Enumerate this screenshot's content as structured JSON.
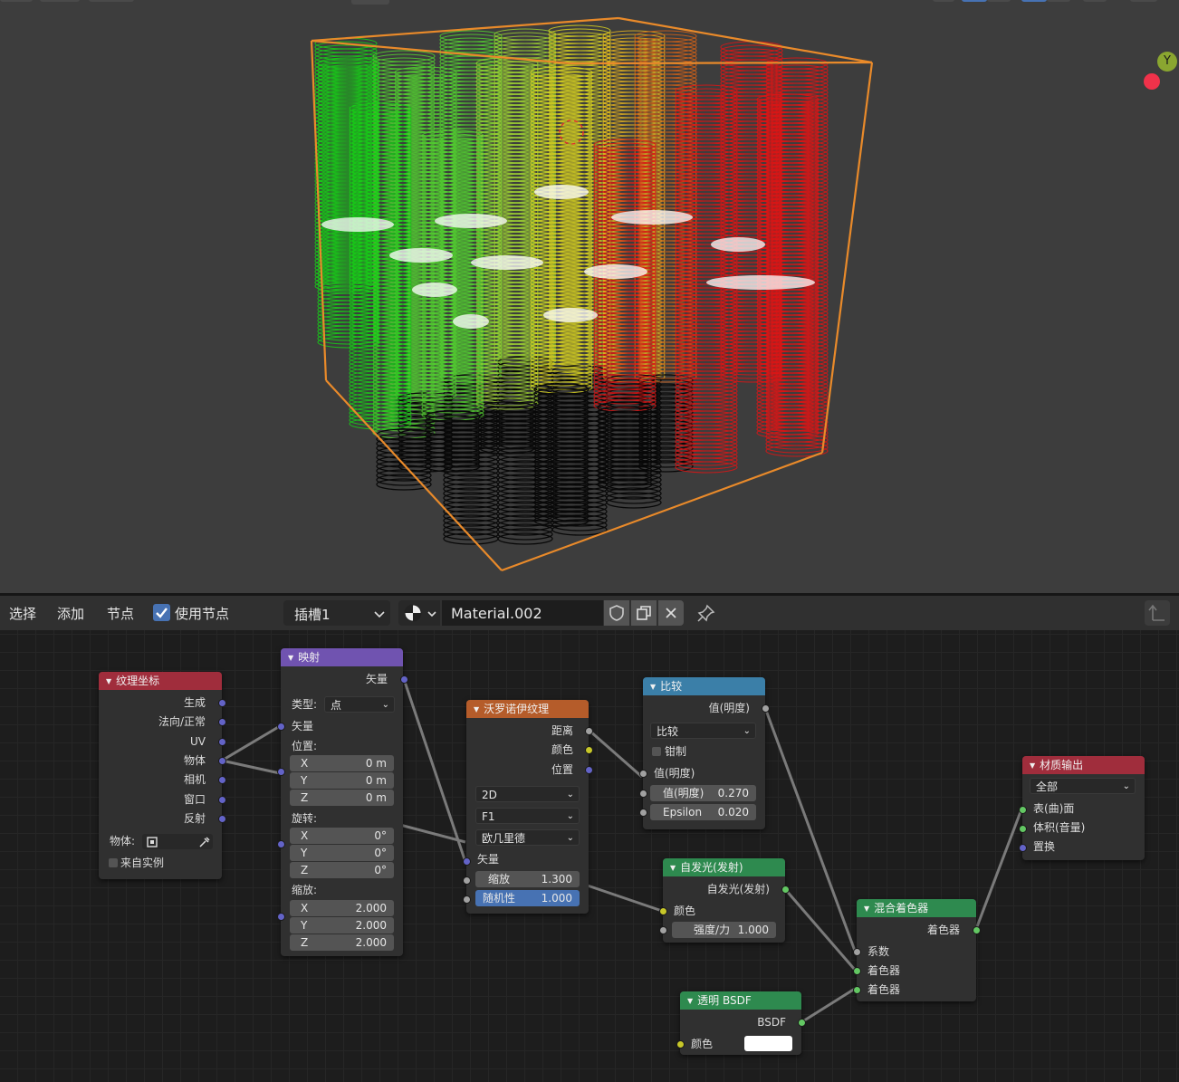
{
  "viewport": {
    "axis_label": "Y",
    "gizmo_color_y": "#8aa630",
    "gizmo_color_x": "#f0324a",
    "bbox_color": "#e98a2a",
    "spring_colors": [
      "#16d016",
      "#52d030",
      "#9acd32",
      "#d6d020",
      "#e0b020",
      "#d06018",
      "#e01414"
    ]
  },
  "header": {
    "menu": [
      "选择",
      "添加",
      "节点"
    ],
    "use_nodes_label": "使用节点",
    "slot": "插槽1",
    "material_name": "Material.002",
    "icons": [
      "sphere-preview-icon",
      "shield-icon",
      "copy-icon",
      "close-icon",
      "pin-icon",
      "parent-icon"
    ]
  },
  "nodes": {
    "tex_coord": {
      "title": "纹理坐标",
      "color": "#a02d3c",
      "outputs": [
        "生成",
        "法向/正常",
        "UV",
        "物体",
        "相机",
        "窗口",
        "反射"
      ],
      "object_label": "物体:",
      "from_instancer": "来自实例"
    },
    "mapping": {
      "title": "映射",
      "color": "#7053b0",
      "output": "矢量",
      "type_label": "类型:",
      "type_value": "点",
      "vector_in": "矢量",
      "location_label": "位置:",
      "location": [
        {
          "axis": "X",
          "value": "0 m"
        },
        {
          "axis": "Y",
          "value": "0 m"
        },
        {
          "axis": "Z",
          "value": "0 m"
        }
      ],
      "rotation_label": "旋转:",
      "rotation": [
        {
          "axis": "X",
          "value": "0°"
        },
        {
          "axis": "Y",
          "value": "0°"
        },
        {
          "axis": "Z",
          "value": "0°"
        }
      ],
      "scale_label": "缩放:",
      "scale": [
        {
          "axis": "X",
          "value": "2.000"
        },
        {
          "axis": "Y",
          "value": "2.000"
        },
        {
          "axis": "Z",
          "value": "2.000"
        }
      ]
    },
    "voronoi": {
      "title": "沃罗诺伊纹理",
      "color": "#b55c2a",
      "outputs": [
        "距离",
        "颜色",
        "位置"
      ],
      "dim": "2D",
      "feature": "F1",
      "metric": "欧几里德",
      "vector_in": "矢量",
      "scale_label": "缩放",
      "scale_value": "1.300",
      "random_label": "随机性",
      "random_value": "1.000"
    },
    "compare": {
      "title": "比较",
      "color": "#3b7fa8",
      "output": "值(明度)",
      "op": "比较",
      "clamp": "钳制",
      "value_in": "值(明度)",
      "value_label": "值(明度)",
      "value": "0.270",
      "eps_label": "Epsilon",
      "eps": "0.020"
    },
    "emission": {
      "title": "自发光(发射)",
      "color": "#2e8a4f",
      "output": "自发光(发射)",
      "color_in": "颜色",
      "strength_label": "强度/力",
      "strength": "1.000"
    },
    "mix": {
      "title": "混合着色器",
      "color": "#2e8a4f",
      "output": "着色器",
      "inputs": [
        "系数",
        "着色器",
        "着色器"
      ]
    },
    "transparent": {
      "title": "透明 BSDF",
      "color": "#2e8a4f",
      "output": "BSDF",
      "color_in": "颜色",
      "swatch": "#ffffff"
    },
    "output": {
      "title": "材质输出",
      "color": "#a02d3c",
      "target": "全部",
      "inputs": [
        "表(曲)面",
        "体积(音量)",
        "置换"
      ]
    }
  }
}
